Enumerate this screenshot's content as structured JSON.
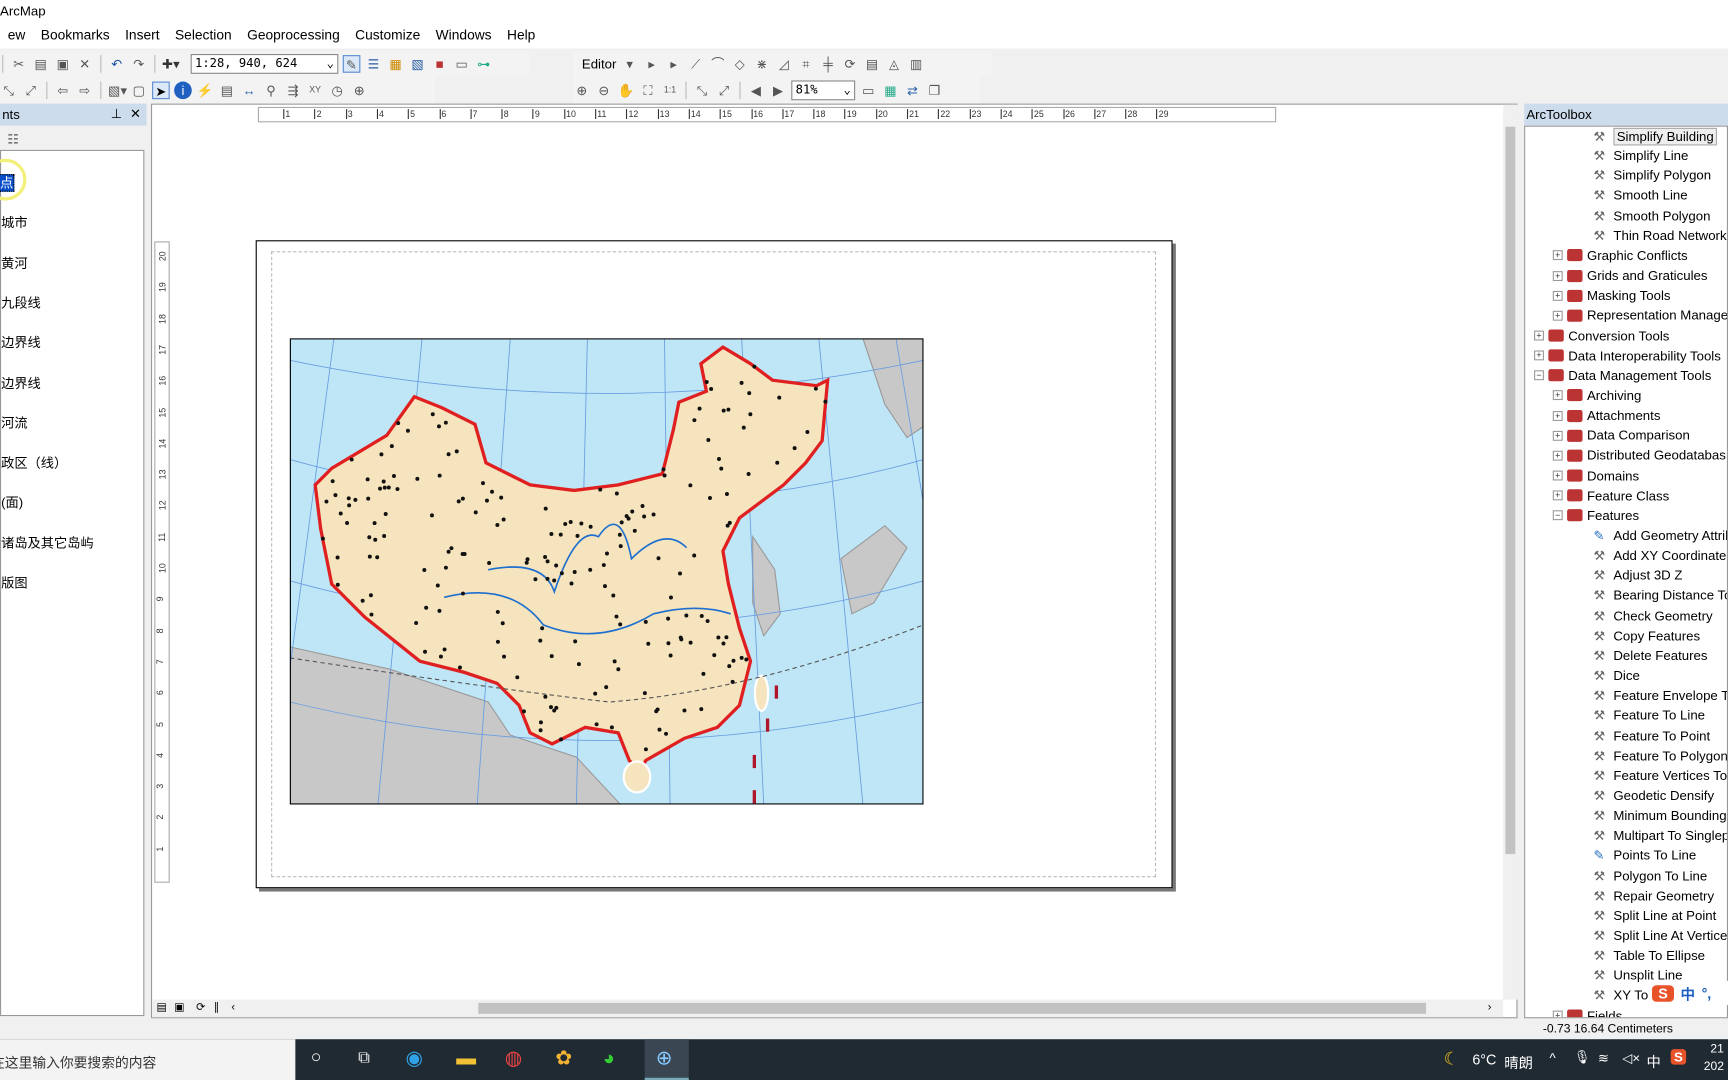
{
  "app": {
    "title": "ArcMap"
  },
  "menu": [
    "ew",
    "Bookmarks",
    "Insert",
    "Selection",
    "Geoprocessing",
    "Customize",
    "Windows",
    "Help"
  ],
  "toolbar": {
    "scale": "1:28, 940, 624",
    "editor": "Editor",
    "zoom": "81%"
  },
  "toc": {
    "title": "nts",
    "items": [
      "点",
      "城市",
      "黄河",
      "九段线",
      "边界线",
      "边界线",
      "河流",
      "政区（线）",
      "(面)",
      "诸岛及其它岛屿",
      "版图"
    ],
    "selected_index": 0
  },
  "ruler": {
    "h": [
      "1",
      "2",
      "3",
      "4",
      "5",
      "6",
      "7",
      "8",
      "9",
      "10",
      "11",
      "12",
      "13",
      "14",
      "15",
      "16",
      "17",
      "18",
      "19",
      "20",
      "21",
      "22",
      "23",
      "24",
      "25",
      "26",
      "27",
      "28",
      "29"
    ],
    "v": [
      "20",
      "19",
      "18",
      "17",
      "16",
      "15",
      "14",
      "13",
      "12",
      "11",
      "10",
      "9",
      "8",
      "7",
      "6",
      "5",
      "4",
      "3",
      "2",
      "1"
    ]
  },
  "toolbox": {
    "title": "ArcToolbox",
    "items": [
      {
        "level": 2,
        "type": "tool",
        "label": "Simplify Building"
      },
      {
        "level": 2,
        "type": "tool",
        "label": "Simplify Line"
      },
      {
        "level": 2,
        "type": "tool",
        "label": "Simplify Polygon"
      },
      {
        "level": 2,
        "type": "tool",
        "label": "Smooth Line"
      },
      {
        "level": 2,
        "type": "tool",
        "label": "Smooth Polygon"
      },
      {
        "level": 2,
        "type": "tool",
        "label": "Thin Road Network"
      },
      {
        "level": 1,
        "type": "set",
        "label": "Graphic Conflicts"
      },
      {
        "level": 1,
        "type": "set",
        "label": "Grids and Graticules"
      },
      {
        "level": 1,
        "type": "set",
        "label": "Masking Tools"
      },
      {
        "level": 1,
        "type": "set",
        "label": "Representation Manage"
      },
      {
        "level": 0,
        "type": "set",
        "label": "Conversion Tools"
      },
      {
        "level": 0,
        "type": "set",
        "label": "Data Interoperability Tools"
      },
      {
        "level": 0,
        "type": "open",
        "label": "Data Management Tools"
      },
      {
        "level": 1,
        "type": "set",
        "label": "Archiving"
      },
      {
        "level": 1,
        "type": "set",
        "label": "Attachments"
      },
      {
        "level": 1,
        "type": "set",
        "label": "Data Comparison"
      },
      {
        "level": 1,
        "type": "set",
        "label": "Distributed Geodatabas"
      },
      {
        "level": 1,
        "type": "set",
        "label": "Domains"
      },
      {
        "level": 1,
        "type": "set",
        "label": "Feature Class"
      },
      {
        "level": 1,
        "type": "open",
        "label": "Features"
      },
      {
        "level": 2,
        "type": "script",
        "label": "Add Geometry Attrib"
      },
      {
        "level": 2,
        "type": "tool",
        "label": "Add XY Coordinates"
      },
      {
        "level": 2,
        "type": "tool",
        "label": "Adjust 3D Z"
      },
      {
        "level": 2,
        "type": "tool",
        "label": "Bearing Distance To"
      },
      {
        "level": 2,
        "type": "tool",
        "label": "Check Geometry"
      },
      {
        "level": 2,
        "type": "tool",
        "label": "Copy Features"
      },
      {
        "level": 2,
        "type": "tool",
        "label": "Delete Features"
      },
      {
        "level": 2,
        "type": "tool",
        "label": "Dice"
      },
      {
        "level": 2,
        "type": "tool",
        "label": "Feature Envelope To"
      },
      {
        "level": 2,
        "type": "tool",
        "label": "Feature To Line"
      },
      {
        "level": 2,
        "type": "tool",
        "label": "Feature To Point"
      },
      {
        "level": 2,
        "type": "tool",
        "label": "Feature To Polygon"
      },
      {
        "level": 2,
        "type": "tool",
        "label": "Feature Vertices To P"
      },
      {
        "level": 2,
        "type": "tool",
        "label": "Geodetic Densify"
      },
      {
        "level": 2,
        "type": "tool",
        "label": "Minimum Bounding G"
      },
      {
        "level": 2,
        "type": "tool",
        "label": "Multipart To Singlepa"
      },
      {
        "level": 2,
        "type": "script",
        "label": "Points To Line"
      },
      {
        "level": 2,
        "type": "tool",
        "label": "Polygon To Line"
      },
      {
        "level": 2,
        "type": "tool",
        "label": "Repair Geometry"
      },
      {
        "level": 2,
        "type": "tool",
        "label": "Split Line at Point"
      },
      {
        "level": 2,
        "type": "tool",
        "label": "Split Line At Vertices"
      },
      {
        "level": 2,
        "type": "tool",
        "label": "Table To Ellipse"
      },
      {
        "level": 2,
        "type": "tool",
        "label": "Unsplit Line"
      },
      {
        "level": 2,
        "type": "tool",
        "label": "XY To L"
      },
      {
        "level": 1,
        "type": "set",
        "label": "Fields"
      }
    ]
  },
  "status": {
    "coords": "-0.73  16.64 Centimeters"
  },
  "ime": {
    "lang": "中",
    "punct": "°,"
  },
  "taskbar": {
    "search": "在这里输入你要搜索的内容",
    "weather": "6°C",
    "weather_desc": "晴朗",
    "ime": "中",
    "time": "21",
    "date": "202"
  },
  "colors": {
    "china_fill": "#f5e4bd",
    "sea": "#bfe6f7",
    "land": "#c8c8c8",
    "border": "#e02020",
    "toc_panel_header": "#cddcec",
    "taskbar": "#202a33"
  }
}
